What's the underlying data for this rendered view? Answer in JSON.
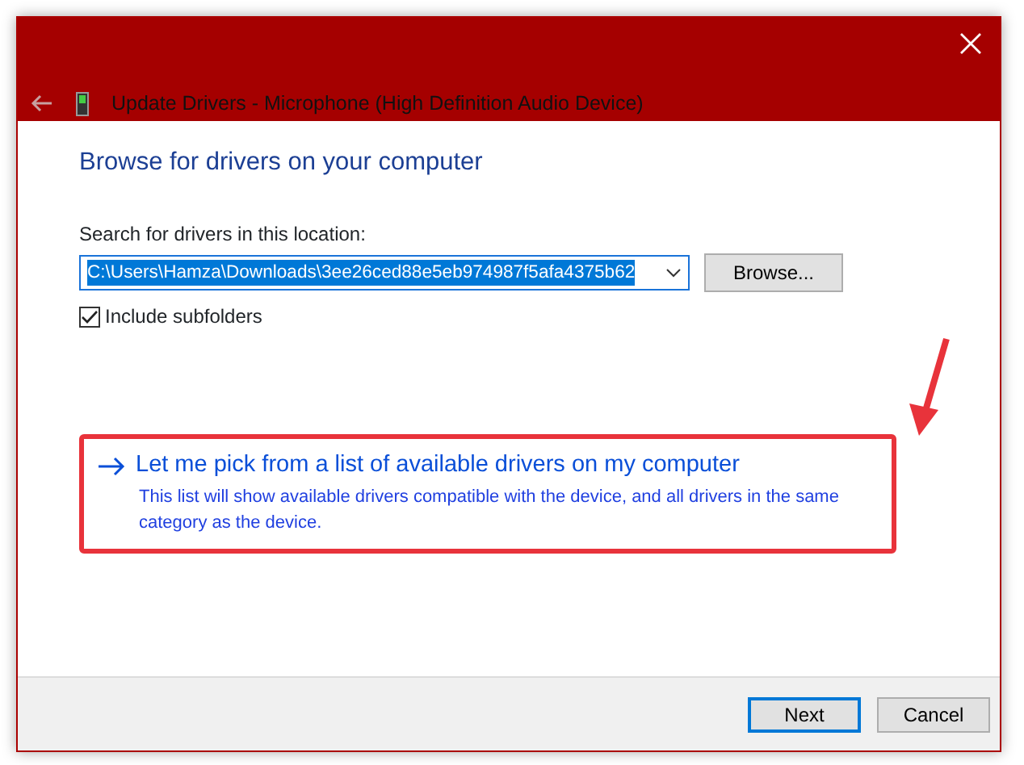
{
  "window": {
    "title": "Update Drivers - Microphone (High Definition Audio Device)"
  },
  "heading": "Browse for drivers on your computer",
  "location": {
    "label": "Search for drivers in this location:",
    "value": "C:\\Users\\Hamza\\Downloads\\3ee26ced88e5eb974987f5afa4375b62",
    "text_selected": true
  },
  "browse_button": "Browse...",
  "include_subfolders": {
    "label": "Include subfolders",
    "checked": true
  },
  "pick_option": {
    "title": "Let me pick from a list of available drivers on my computer",
    "description": "This list will show available drivers compatible with the device, and all drivers in the same category as the device.",
    "highlighted": true
  },
  "buttons": [
    {
      "label": "Next",
      "default": true
    },
    {
      "label": "Cancel",
      "default": false
    }
  ]
}
